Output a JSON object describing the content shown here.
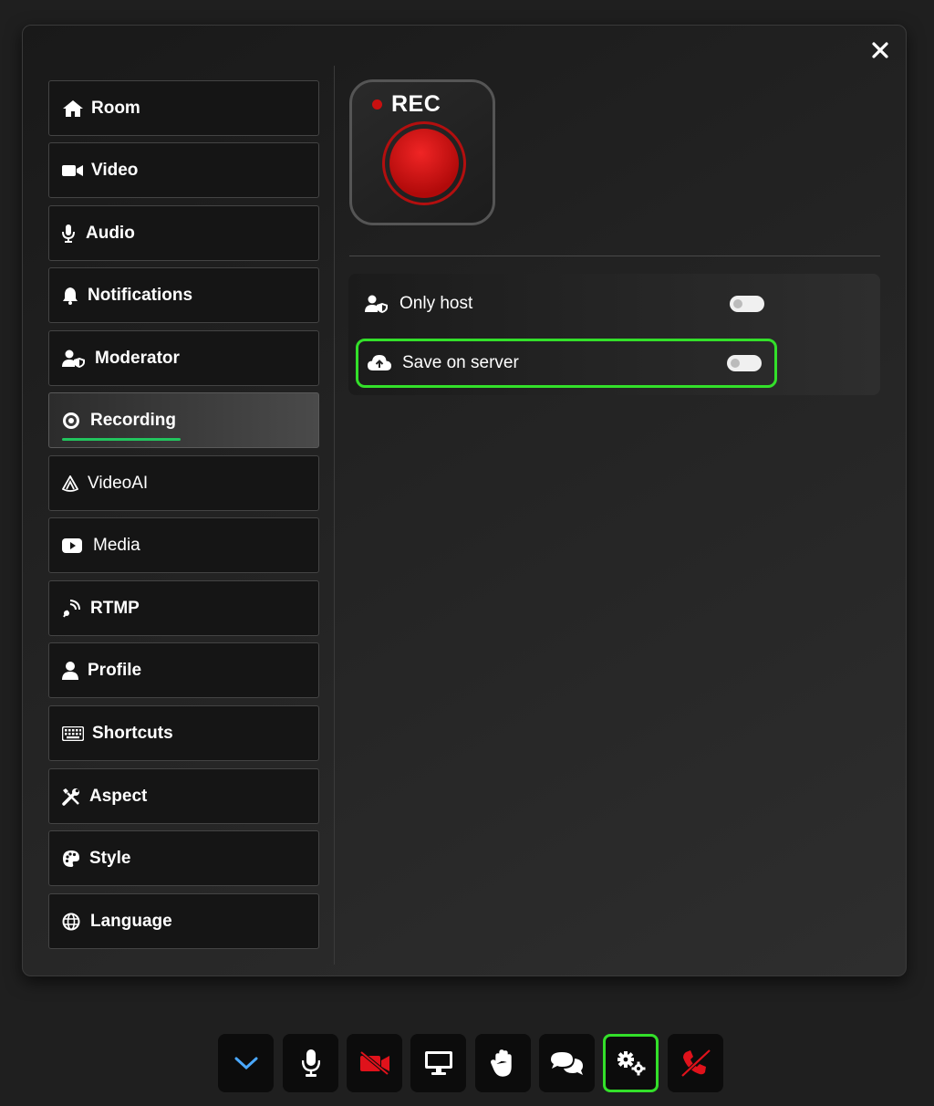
{
  "dialog": {
    "close_icon": "close-icon"
  },
  "sidebar": {
    "items": [
      {
        "label": "Room",
        "icon": "home-icon"
      },
      {
        "label": "Video",
        "icon": "video-camera-icon"
      },
      {
        "label": "Audio",
        "icon": "microphone-icon"
      },
      {
        "label": "Notifications",
        "icon": "bell-icon"
      },
      {
        "label": "Moderator",
        "icon": "user-shield-icon"
      },
      {
        "label": "Recording",
        "icon": "record-icon",
        "active": true
      },
      {
        "label": "VideoAI",
        "icon": "ai-icon"
      },
      {
        "label": "Media",
        "icon": "youtube-icon"
      },
      {
        "label": "RTMP",
        "icon": "broadcast-icon"
      },
      {
        "label": "Profile",
        "icon": "user-icon"
      },
      {
        "label": "Shortcuts",
        "icon": "keyboard-icon"
      },
      {
        "label": "Aspect",
        "icon": "tools-icon"
      },
      {
        "label": "Style",
        "icon": "palette-icon"
      },
      {
        "label": "Language",
        "icon": "globe-icon"
      }
    ]
  },
  "recording": {
    "rec_label": "REC",
    "settings": [
      {
        "label": "Only host",
        "icon": "user-shield-icon",
        "enabled": false
      },
      {
        "label": "Save on server",
        "icon": "cloud-upload-icon",
        "enabled": false
      }
    ]
  },
  "toolbar": {
    "buttons": [
      {
        "icon": "chevron-down-icon",
        "color": "#4aa8ff"
      },
      {
        "icon": "microphone-icon",
        "color": "#ffffff"
      },
      {
        "icon": "video-off-icon",
        "color": "#e0121b"
      },
      {
        "icon": "screen-share-icon",
        "color": "#ffffff"
      },
      {
        "icon": "hand-icon",
        "color": "#ffffff"
      },
      {
        "icon": "chat-icon",
        "color": "#ffffff"
      },
      {
        "icon": "settings-icon",
        "color": "#ffffff",
        "active": true
      },
      {
        "icon": "leave-call-icon",
        "color": "#e0121b"
      }
    ]
  },
  "colors": {
    "accent_green": "#33e02a",
    "record_red": "#c81010",
    "underline_green": "#22c55e"
  }
}
